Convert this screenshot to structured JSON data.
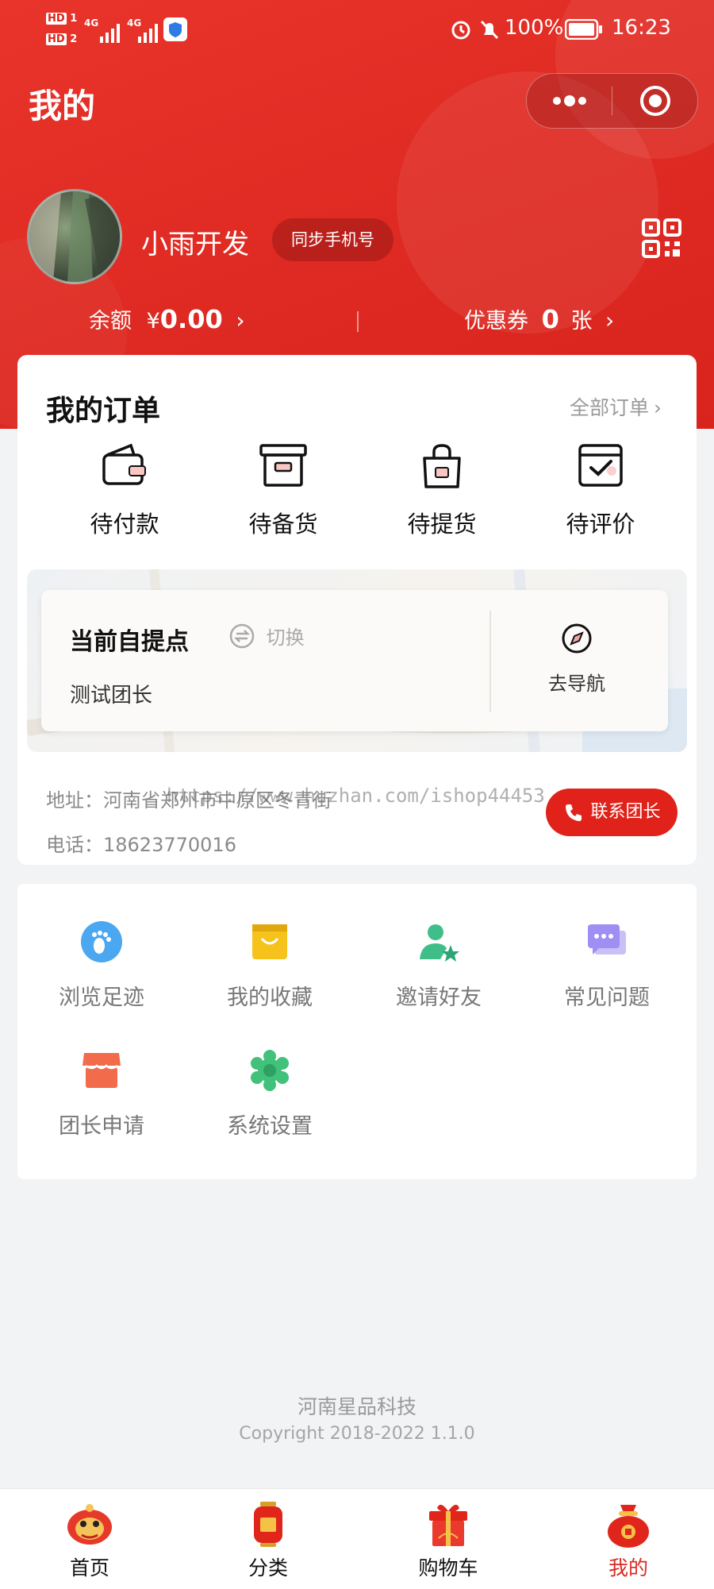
{
  "status_bar": {
    "hd1": "HD",
    "hd1_num": "1",
    "hd2": "HD",
    "hd2_num": "2",
    "net1": "4G",
    "net2": "4G",
    "battery": "100%",
    "time": "16:23"
  },
  "page": {
    "title": "我的"
  },
  "user": {
    "nickname": "小雨开发",
    "sync_label": "同步手机号"
  },
  "balance": {
    "label": "余额",
    "currency": "¥",
    "value": "0.00"
  },
  "coupons": {
    "label": "优惠券",
    "count": "0",
    "unit": "张"
  },
  "orders": {
    "title": "我的订单",
    "all_label": "全部订单",
    "items": [
      {
        "label": "待付款",
        "icon": "wallet-icon"
      },
      {
        "label": "待备货",
        "icon": "box-icon"
      },
      {
        "label": "待提货",
        "icon": "bag-icon"
      },
      {
        "label": "待评价",
        "icon": "review-icon"
      }
    ]
  },
  "pickup": {
    "title": "当前自提点",
    "switch_label": "切换",
    "leader": "测试团长",
    "nav_label": "去导航",
    "address_label": "地址：",
    "address": "河南省郑州市中原区冬青街",
    "phone_label": "电话：",
    "phone": "18623770016",
    "contact_label": "联系团长"
  },
  "watermark": "https://www.huzhan.com/ishop44453",
  "tools": [
    {
      "label": "浏览足迹",
      "icon": "footprint-icon",
      "color": "#4ba7f0"
    },
    {
      "label": "我的收藏",
      "icon": "bag-favorite-icon",
      "color": "#f6c21c"
    },
    {
      "label": "邀请好友",
      "icon": "invite-user-icon",
      "color": "#3fbe8a"
    },
    {
      "label": "常见问题",
      "icon": "chat-icon",
      "color": "#9f8ef3"
    },
    {
      "label": "团长申请",
      "icon": "shop-icon",
      "color": "#f26b4a"
    },
    {
      "label": "系统设置",
      "icon": "gear-icon",
      "color": "#41c17a"
    }
  ],
  "footer": {
    "company": "河南星品科技",
    "copyright": "Copyright 2018-2022 1.1.0"
  },
  "tabbar": [
    {
      "label": "首页",
      "icon": "lion-icon",
      "active": false
    },
    {
      "label": "分类",
      "icon": "lantern-icon",
      "active": false
    },
    {
      "label": "购物车",
      "icon": "giftbox-icon",
      "active": false
    },
    {
      "label": "我的",
      "icon": "money-bag-icon",
      "active": true
    }
  ],
  "colors": {
    "brand_red": "#e0221b",
    "active_tab": "#d92a22"
  }
}
